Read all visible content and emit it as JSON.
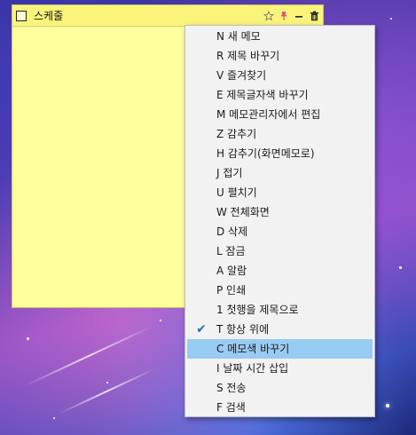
{
  "note": {
    "title": "스케줄",
    "buttons": {
      "favorite_icon": "star-outline-icon",
      "pin_icon": "pin-icon",
      "minimize_icon": "minimize-icon",
      "delete_icon": "trash-icon"
    },
    "colors": {
      "body": "#fefe9c",
      "titlebar": "#fbf47a"
    }
  },
  "context_menu": {
    "items": [
      {
        "label": "N 새 메모",
        "checked": false,
        "highlighted": false
      },
      {
        "label": "R 제목 바꾸기",
        "checked": false,
        "highlighted": false
      },
      {
        "label": "V 즐겨찾기",
        "checked": false,
        "highlighted": false
      },
      {
        "label": "E 제목글자색 바꾸기",
        "checked": false,
        "highlighted": false
      },
      {
        "label": "M 메모관리자에서 편집",
        "checked": false,
        "highlighted": false
      },
      {
        "label": "Z 감추기",
        "checked": false,
        "highlighted": false
      },
      {
        "label": "H 감추기(화면메모로)",
        "checked": false,
        "highlighted": false
      },
      {
        "label": "J 접기",
        "checked": false,
        "highlighted": false
      },
      {
        "label": "U 펼치기",
        "checked": false,
        "highlighted": false
      },
      {
        "label": "W 전체화면",
        "checked": false,
        "highlighted": false
      },
      {
        "label": "D 삭제",
        "checked": false,
        "highlighted": false
      },
      {
        "label": "L 잠금",
        "checked": false,
        "highlighted": false
      },
      {
        "label": "A 알람",
        "checked": false,
        "highlighted": false
      },
      {
        "label": "P 인쇄",
        "checked": false,
        "highlighted": false
      },
      {
        "label": "1 첫행을 제목으로",
        "checked": false,
        "highlighted": false
      },
      {
        "label": "T 항상 위에",
        "checked": true,
        "highlighted": false
      },
      {
        "label": "C 메모색 바꾸기",
        "checked": false,
        "highlighted": true
      },
      {
        "label": "I 날짜 시간 삽입",
        "checked": false,
        "highlighted": false
      },
      {
        "label": "S 전송",
        "checked": false,
        "highlighted": false
      },
      {
        "label": "F 검색",
        "checked": false,
        "highlighted": false
      }
    ],
    "colors": {
      "background": "#f2f2f2",
      "highlight": "#99ccf3",
      "check": "#2a6fbd"
    }
  }
}
